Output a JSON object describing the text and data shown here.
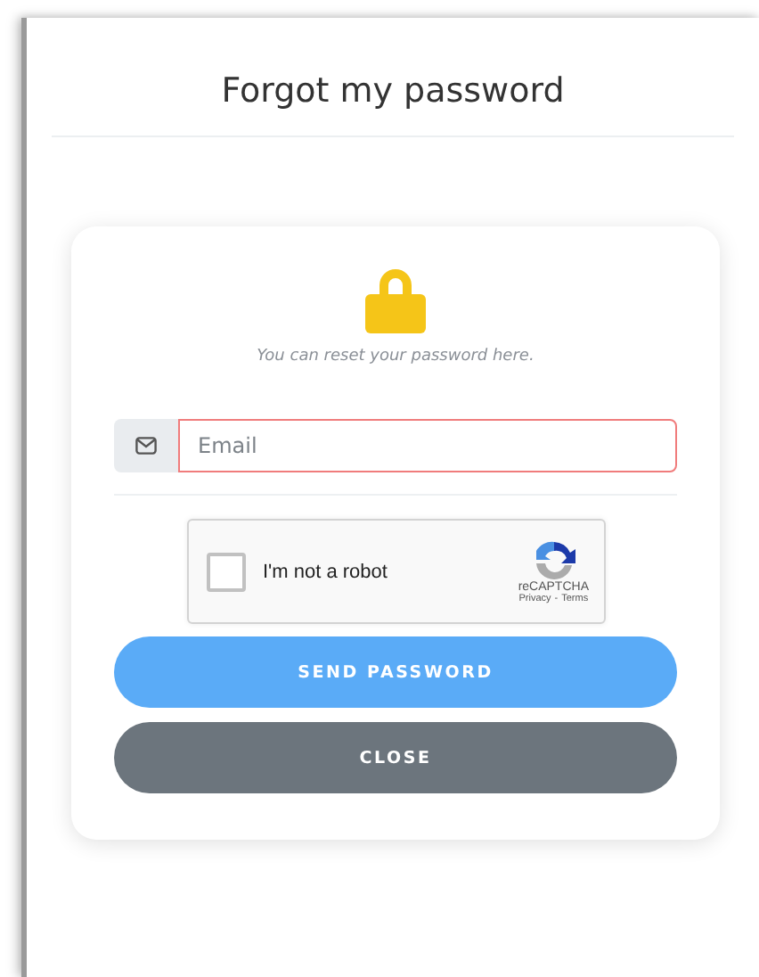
{
  "dialog": {
    "title": "Forgot my password"
  },
  "hint": "You can reset your password here.",
  "email": {
    "placeholder": "Email",
    "invalid": true
  },
  "captcha": {
    "label": "I'm not a robot",
    "checked": false,
    "brand": "reCAPTCHA",
    "privacy": "Privacy",
    "separator": "-",
    "terms": "Terms"
  },
  "buttons": [
    {
      "label": "SEND PASSWORD",
      "kind": "primary"
    },
    {
      "label": "CLOSE",
      "kind": "secondary"
    }
  ]
}
